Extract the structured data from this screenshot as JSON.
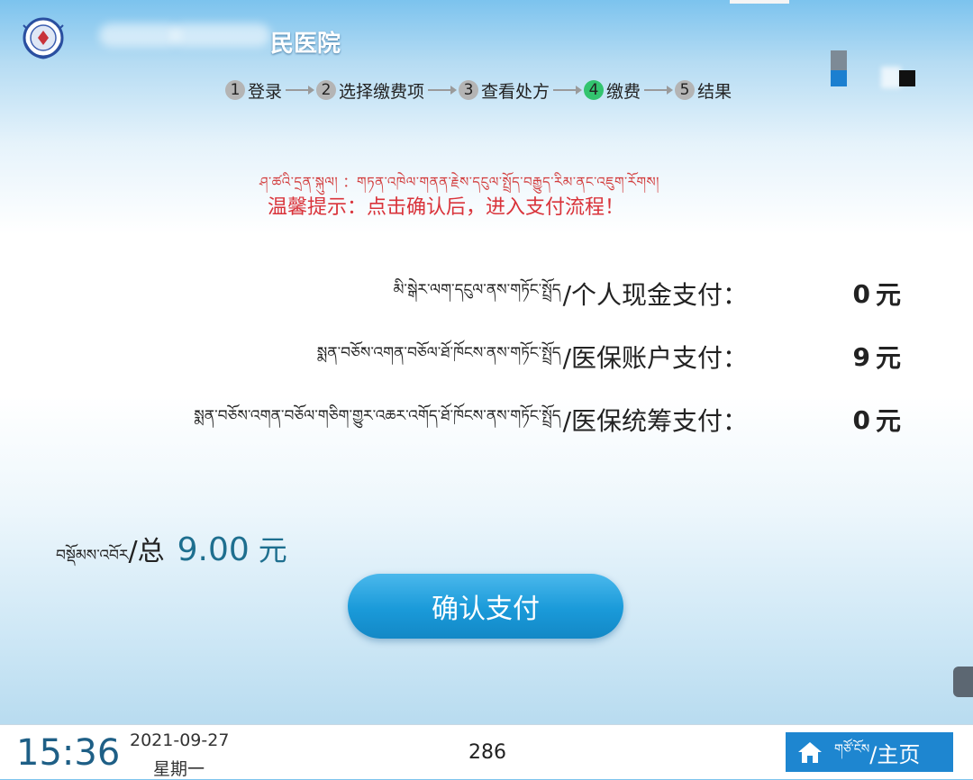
{
  "header": {
    "hospital_name": "民医院",
    "logo_icon": "hospital-emblem-icon",
    "steps": [
      {
        "num": "1",
        "label": "登录"
      },
      {
        "num": "2",
        "label": "选择缴费项"
      },
      {
        "num": "3",
        "label": "查看处方"
      },
      {
        "num": "4",
        "label": "缴费",
        "active": true
      },
      {
        "num": "5",
        "label": "结果"
      }
    ]
  },
  "notice": {
    "tibetan": "ཤ་ཚའི་དྲན་སྐུལ། ：གཏན་འཁེལ་གནན་རྗེས་དངུལ་སྤྲོད་བརྒྱུད་རིམ་ནང་འཇུག་རོགས།",
    "text": "温馨提示：点击确认后，进入支付流程！"
  },
  "payments": [
    {
      "tibetan": "མི་སྒེར་ལག་དངུལ་ནས་གཏོང་སྤྲོད",
      "label": "/个人现金支付：",
      "amount": "0",
      "unit": "元"
    },
    {
      "tibetan": "སྨན་བཅོས་འགན་བཅོལ་ཐོ་ཁོངས་ནས་གཏོང་སྤྲོད",
      "label": "/医保账户支付：",
      "amount": "9",
      "unit": "元"
    },
    {
      "tibetan": "སྨན་བཅོས་འགན་བཅོལ་གཅིག་གྱུར་འཆར་འགོད་ཐོ་ཁོངས་ནས་གཏོང་སྤྲོད",
      "label": "/医保统筹支付：",
      "amount": "0",
      "unit": "元"
    }
  ],
  "total": {
    "tibetan": "བསྡོམས་འབོར",
    "label": "/总",
    "value": "9.00",
    "unit": "元"
  },
  "confirm_button": {
    "label": "确认支付"
  },
  "footer": {
    "time": "15:36",
    "date": "2021-09-27",
    "weekday": "星期一",
    "counter": "286",
    "home_button": {
      "tibetan": "གཙོ་ངོས",
      "label": "/主页",
      "icon": "home-icon"
    }
  },
  "colors": {
    "accent": "#1e86d0",
    "active_step": "#33c46f",
    "notice": "#d9333a",
    "total": "#1e6f8f"
  }
}
